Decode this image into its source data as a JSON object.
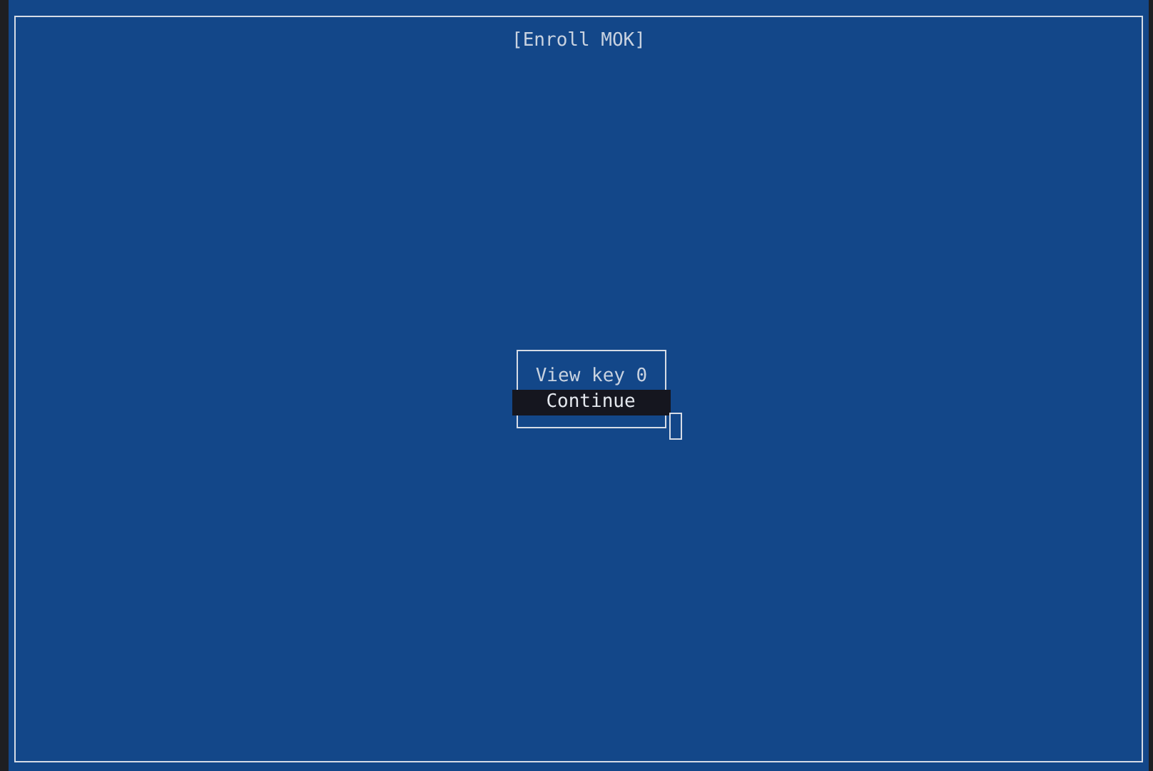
{
  "screen": {
    "title": "[Enroll MOK]"
  },
  "menu": {
    "items": [
      {
        "label": "View key 0",
        "selected": false
      },
      {
        "label": "Continue",
        "selected": true
      }
    ]
  }
}
